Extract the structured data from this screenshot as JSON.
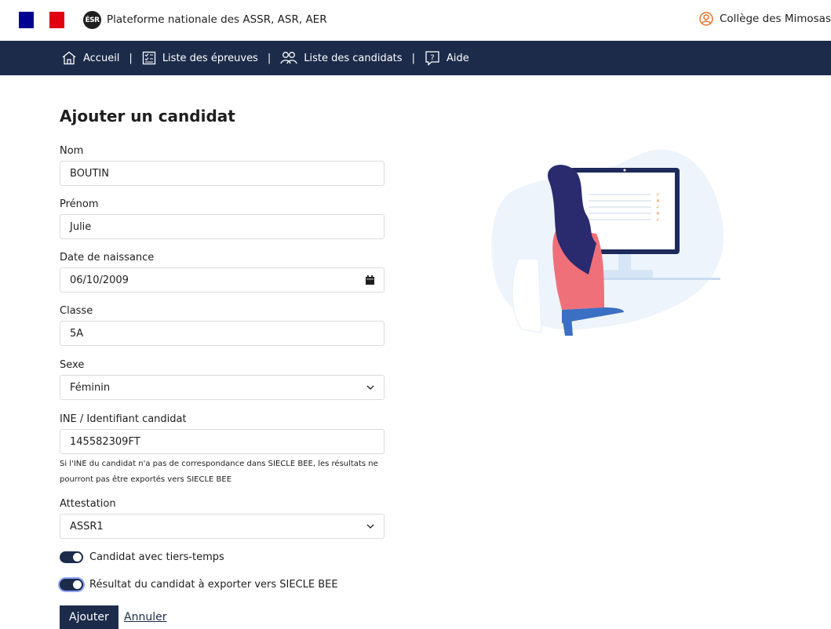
{
  "header": {
    "esr_logo_text": "ÉSR",
    "platform_title": "Plateforme nationale des ASSR, ASR, AER",
    "school_name": "Collège des Mimosas"
  },
  "nav": {
    "items": [
      {
        "label": "Accueil",
        "icon": "home-icon"
      },
      {
        "label": "Liste des épreuves",
        "icon": "checklist-icon"
      },
      {
        "label": "Liste des candidats",
        "icon": "users-icon"
      },
      {
        "label": "Aide",
        "icon": "help-icon"
      }
    ],
    "separator": "|"
  },
  "form": {
    "title": "Ajouter un candidat",
    "fields": {
      "nom": {
        "label": "Nom",
        "value": "BOUTIN"
      },
      "prenom": {
        "label": "Prénom",
        "value": "Julie"
      },
      "date_naissance": {
        "label": "Date de naissance",
        "value": "06/10/2009",
        "icon": "calendar-icon"
      },
      "classe": {
        "label": "Classe",
        "value": "5A"
      },
      "sexe": {
        "label": "Sexe",
        "value": "Féminin",
        "icon": "chevron-down-icon"
      },
      "ine": {
        "label": "INE / Identifiant candidat",
        "value": "145582309FT"
      },
      "attestation": {
        "label": "Attestation",
        "value": "ASSR1",
        "icon": "chevron-down-icon"
      }
    },
    "ine_hint": "Si l'INE du candidat n'a pas de correspondance dans SIECLE BEE, les résultats ne pourront pas être exportés vers SIECLE BEE",
    "toggles": {
      "tiers_temps": {
        "label": "Candidat avec tiers-temps",
        "on": true
      },
      "export_siecle": {
        "label": "Résultat du candidat à exporter vers SIECLE BEE",
        "on": true
      }
    },
    "submit_label": "Ajouter",
    "cancel_label": "Annuler"
  },
  "colors": {
    "navy": "#1c2b4a",
    "flag_blue": "#000091",
    "flag_red": "#e1000f",
    "accent_orange": "#e8742c"
  }
}
